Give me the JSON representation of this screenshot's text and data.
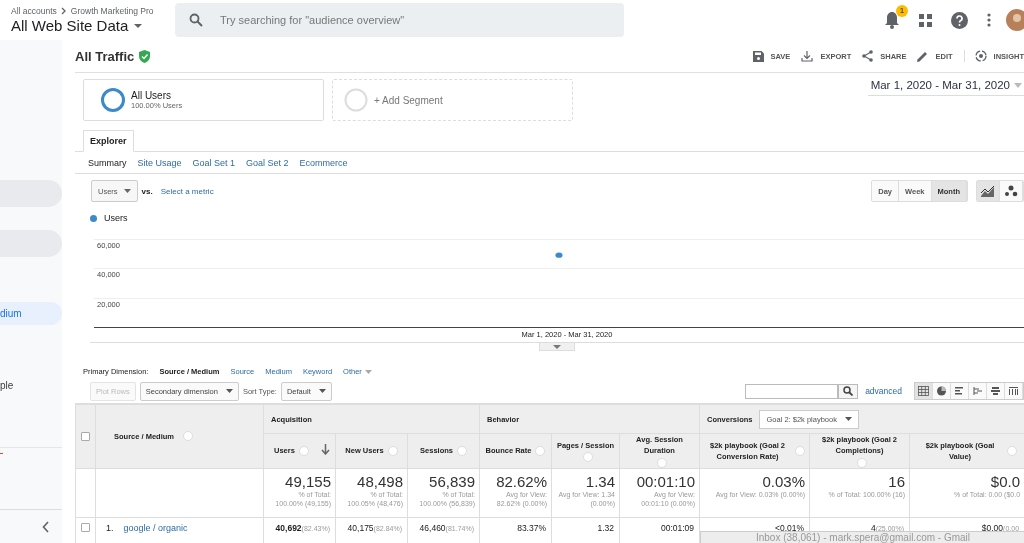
{
  "header": {
    "breadcrumb": [
      "All accounts",
      "Growth Marketing Pro"
    ],
    "property": "All Web Site Data",
    "search": {
      "placeholder": "Try searching for \"audience overview\""
    },
    "notification_count": "1"
  },
  "sidebar": {
    "items": [
      {
        "kind": "pill",
        "selected": false
      },
      {
        "kind": "pill",
        "selected": false
      },
      {
        "kind": "pill",
        "label": "dium",
        "selected": true
      },
      {
        "kind": "text",
        "label": "ple",
        "selected": false
      },
      {
        "kind": "marker"
      }
    ]
  },
  "report": {
    "title": "All Traffic",
    "verified": true,
    "actions": [
      {
        "label": "SAVE",
        "kind": "save"
      },
      {
        "label": "EXPORT",
        "kind": "export"
      },
      {
        "label": "SHARE",
        "kind": "share"
      },
      {
        "label": "EDIT",
        "kind": "edit"
      },
      {
        "label": "INSIGHT",
        "kind": "insights"
      }
    ],
    "segments": [
      {
        "kind": "active",
        "label": "All Users",
        "detail": "100.00% Users"
      },
      {
        "kind": "add",
        "label": "+ Add Segment"
      }
    ],
    "date_range": "Mar 1, 2020 - Mar 31, 2020",
    "tabs": [
      {
        "label": "Explorer",
        "selected": true
      }
    ],
    "subtabs": [
      {
        "label": "Summary",
        "selected": true
      },
      {
        "label": "Site Usage",
        "selected": false
      },
      {
        "label": "Goal Set 1",
        "selected": false
      },
      {
        "label": "Goal Set 2",
        "selected": false
      },
      {
        "label": "Ecommerce",
        "selected": false
      }
    ],
    "metric": "Users",
    "vs": "vs.",
    "compare_link": "Select a metric",
    "granularity": [
      {
        "label": "Day",
        "selected": false
      },
      {
        "label": "Week",
        "selected": false
      },
      {
        "label": "Month",
        "selected": true
      }
    ],
    "chart_types": [
      {
        "kind": "line",
        "selected": true
      },
      {
        "kind": "motion",
        "selected": false
      }
    ],
    "chart_data": {
      "type": "scatter",
      "categories": [
        "Mar 1, 2020 - Mar 31, 2020"
      ],
      "series": [
        {
          "name": "Users",
          "color": "#3c8ac8",
          "values": [
            49000
          ]
        }
      ],
      "ylim": [
        0,
        60000
      ],
      "yticks": [
        {
          "value": 20000,
          "label": "20,000"
        },
        {
          "value": 40000,
          "label": "40,000"
        },
        {
          "value": 60000,
          "label": "60,000"
        }
      ]
    },
    "primary_dimension": {
      "label": "Primary Dimension:",
      "options": [
        {
          "label": "Source / Medium",
          "selected": true,
          "menu": false
        },
        {
          "label": "Source",
          "selected": false,
          "menu": false
        },
        {
          "label": "Medium",
          "selected": false,
          "menu": false
        },
        {
          "label": "Keyword",
          "selected": false,
          "menu": false
        },
        {
          "label": "Other",
          "selected": false,
          "menu": true
        }
      ]
    },
    "toolbar": {
      "plot_rows": {
        "label": "Plot Rows",
        "disabled": true
      },
      "secondary": "Secondary dimension",
      "sort_label": "Sort Type:",
      "sort": "Default",
      "advanced": "advanced",
      "views": [
        {
          "kind": "table",
          "selected": true
        },
        {
          "kind": "pie",
          "selected": false
        },
        {
          "kind": "bars",
          "selected": false
        },
        {
          "kind": "comparison",
          "selected": false
        },
        {
          "kind": "terms",
          "selected": false
        },
        {
          "kind": "pivot",
          "selected": false
        }
      ]
    },
    "table": {
      "dimension": "Source / Medium",
      "all_checked": false,
      "groups": [
        {
          "label": "Acquisition"
        },
        {
          "label": "Behavior"
        },
        {
          "label": "Conversions",
          "goal": "Goal 2: $2k playbook"
        }
      ],
      "columns": [
        {
          "label": "Users",
          "sorted": true
        },
        {
          "label": "New Users",
          "sorted": false
        },
        {
          "label": "Sessions",
          "sorted": false
        },
        {
          "label": "Bounce Rate",
          "sorted": false
        },
        {
          "label": "Pages / Session",
          "sorted": false
        },
        {
          "label": "Avg. Session Duration",
          "sorted": false
        },
        {
          "label": "$2k playbook (Goal 2 Conversion Rate)",
          "sorted": false
        },
        {
          "label": "$2k playbook (Goal 2 Completions)",
          "sorted": false
        },
        {
          "label": "$2k playbook (Goal Value)",
          "sorted": false
        }
      ],
      "totals": [
        {
          "value": "49,155",
          "note": "% of Total: 100.00% (49,155)"
        },
        {
          "value": "48,498",
          "note": "% of Total: 100.05% (48,476)"
        },
        {
          "value": "56,839",
          "note": "% of Total: 100.00% (56,839)"
        },
        {
          "value": "82.62%",
          "note": "Avg for View: 82.62% (0.00%)"
        },
        {
          "value": "1.34",
          "note": "Avg for View: 1.34 (0.00%)"
        },
        {
          "value": "00:01:10",
          "note": "Avg for View: 00:01:10 (0.00%)"
        },
        {
          "value": "0.03%",
          "note": "Avg for View: 0.03% (0.00%)"
        },
        {
          "value": "16",
          "note": "% of Total: 100.00% (16)"
        },
        {
          "value": "$0.0",
          "note": "% of Total: 0.00 ($0.0"
        }
      ],
      "rows": [
        {
          "index": "1.",
          "name": "google / organic",
          "checked": false,
          "cells": [
            {
              "value": "40,692",
              "pct": "(82.43%)",
              "bold": true
            },
            {
              "value": "40,175",
              "pct": "(82.84%)",
              "bold": false
            },
            {
              "value": "46,460",
              "pct": "(81.74%)",
              "bold": false
            },
            {
              "value": "83.37%",
              "bold": false
            },
            {
              "value": "1.32",
              "bold": false
            },
            {
              "value": "00:01:09",
              "bold": false
            },
            {
              "value": "<0.01%",
              "bold": false
            },
            {
              "value": "4",
              "pct": "(25.00%)",
              "bold": false
            },
            {
              "value": "$0.00",
              "pct": "(0.00",
              "bold": false
            }
          ]
        }
      ]
    }
  },
  "tooltip": "Inbox (38,061) - mark.spera@gmail.com - Gmail"
}
